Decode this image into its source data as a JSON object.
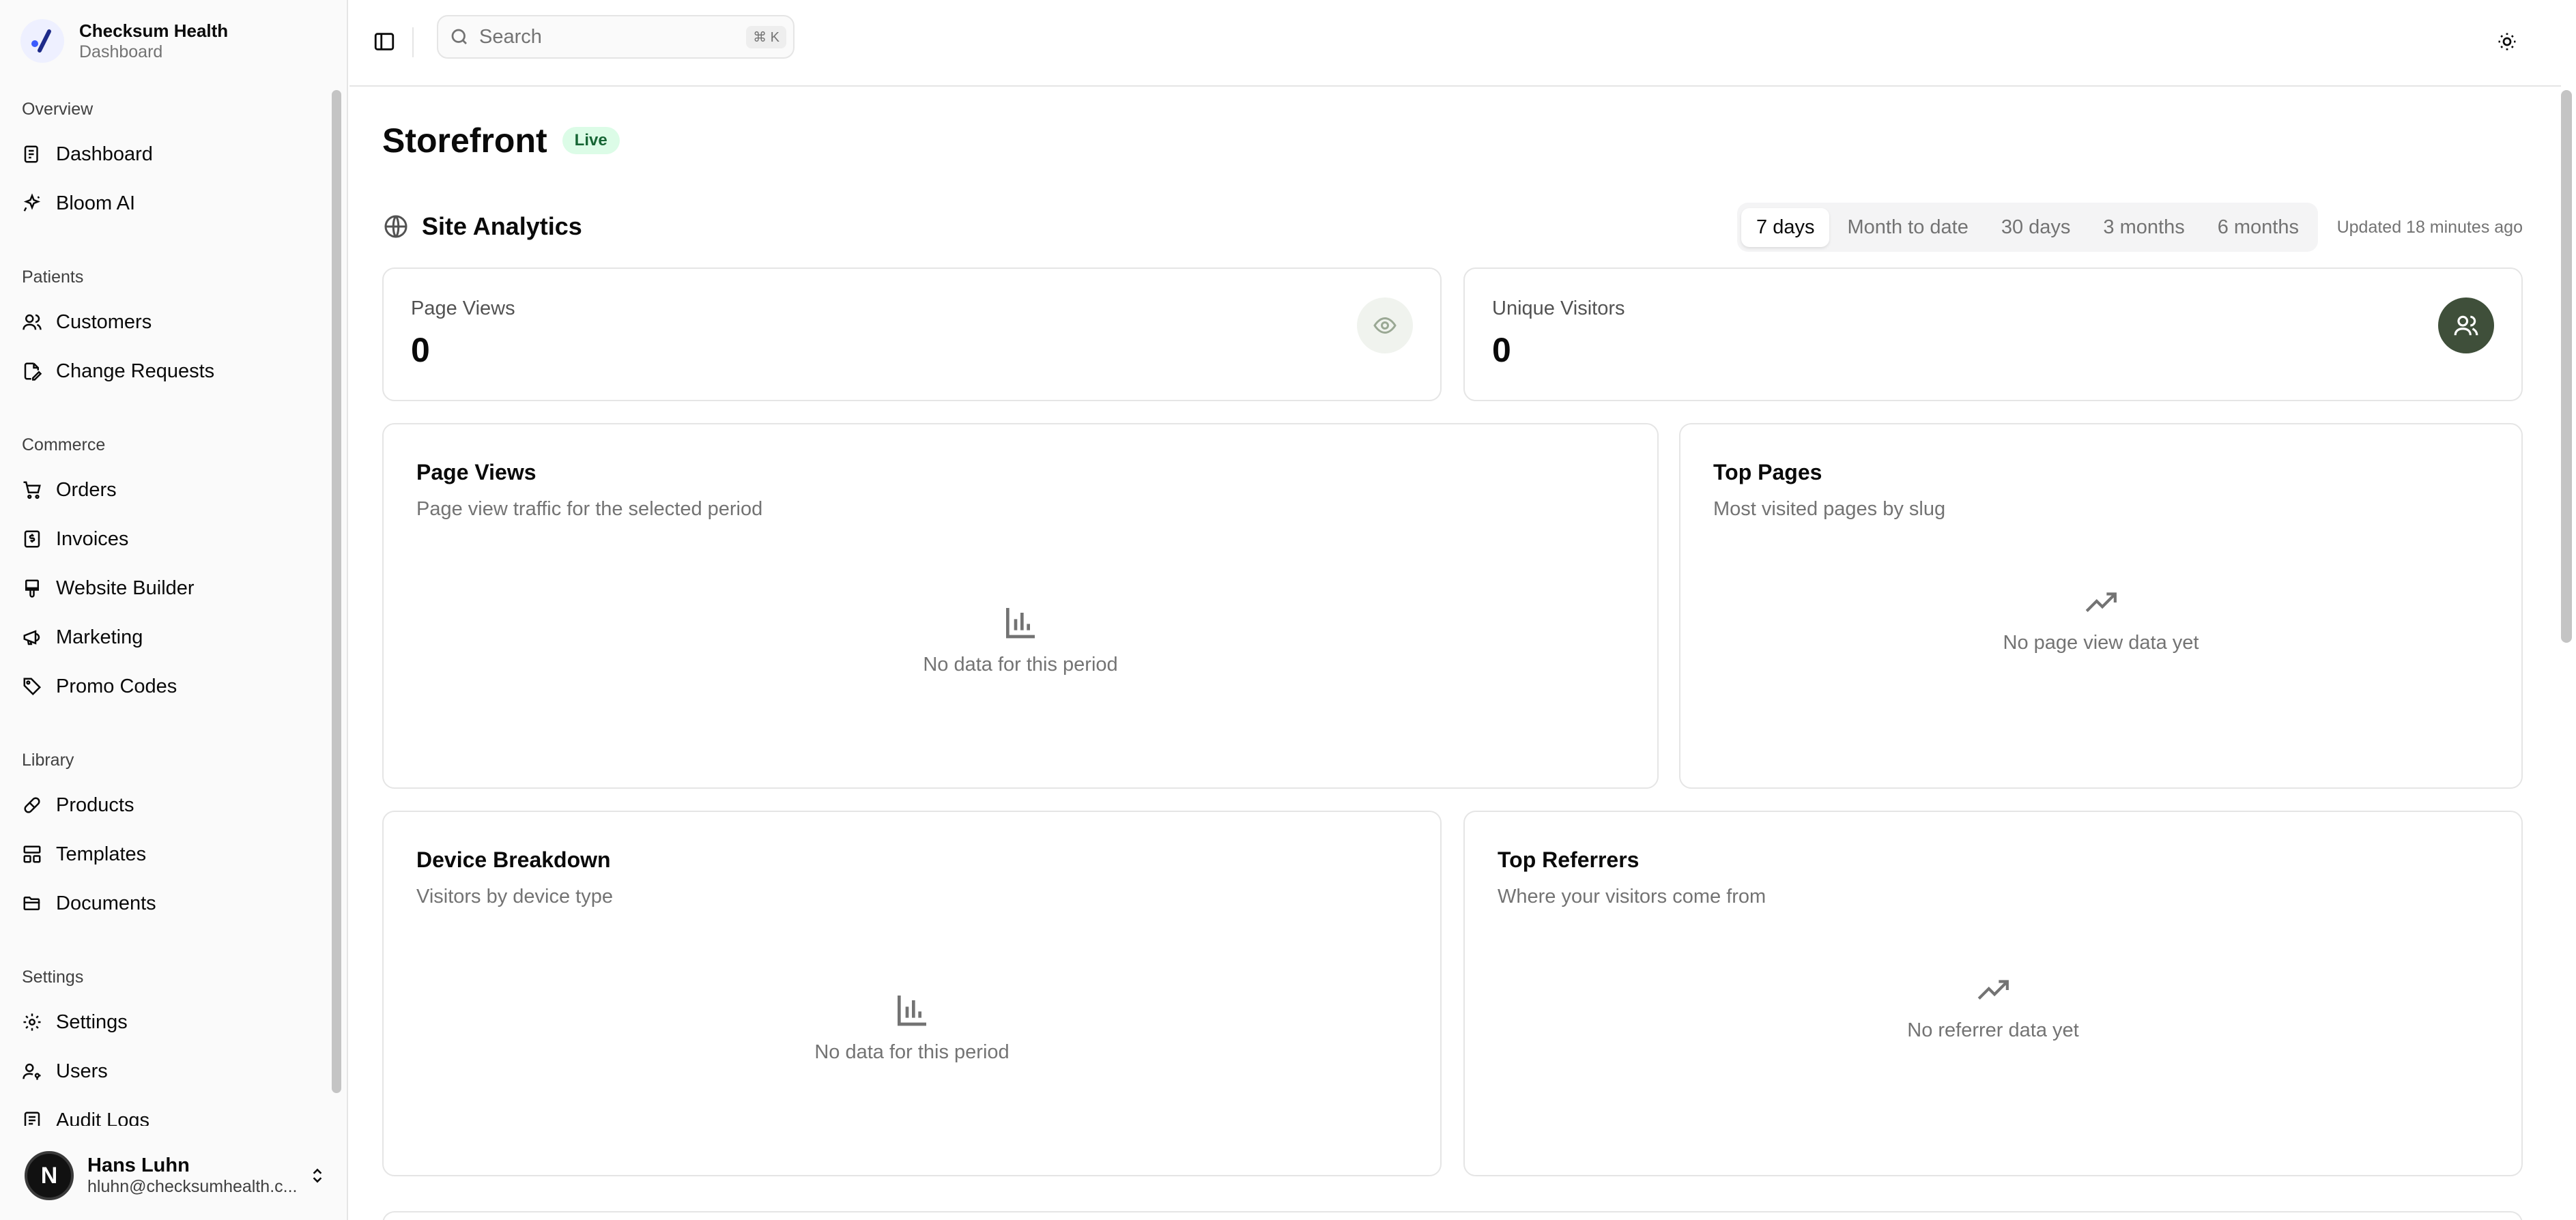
{
  "brand": {
    "name": "Checksum Health",
    "subtitle": "Dashboard"
  },
  "sidebar": {
    "groups": [
      {
        "label": "Overview",
        "items": [
          {
            "label": "Dashboard",
            "icon": "dashboard-icon"
          },
          {
            "label": "Bloom AI",
            "icon": "sparkles-icon"
          }
        ]
      },
      {
        "label": "Patients",
        "items": [
          {
            "label": "Customers",
            "icon": "users-icon"
          },
          {
            "label": "Change Requests",
            "icon": "file-edit-icon"
          }
        ]
      },
      {
        "label": "Commerce",
        "items": [
          {
            "label": "Orders",
            "icon": "cart-icon"
          },
          {
            "label": "Invoices",
            "icon": "invoice-icon"
          },
          {
            "label": "Website Builder",
            "icon": "brush-icon"
          },
          {
            "label": "Marketing",
            "icon": "megaphone-icon"
          },
          {
            "label": "Promo Codes",
            "icon": "tag-icon"
          }
        ]
      },
      {
        "label": "Library",
        "items": [
          {
            "label": "Products",
            "icon": "pill-icon"
          },
          {
            "label": "Templates",
            "icon": "layout-icon"
          },
          {
            "label": "Documents",
            "icon": "folder-icon"
          }
        ]
      },
      {
        "label": "Settings",
        "items": [
          {
            "label": "Settings",
            "icon": "gear-icon"
          },
          {
            "label": "Users",
            "icon": "user-key-icon"
          },
          {
            "label": "Audit Logs",
            "icon": "log-icon"
          }
        ]
      }
    ]
  },
  "user": {
    "initial": "N",
    "name": "Hans Luhn",
    "email": "hluhn@checksumhealth.c..."
  },
  "topbar": {
    "search_placeholder": "Search",
    "shortcut": "⌘ K"
  },
  "page": {
    "title": "Storefront",
    "badge": "Live"
  },
  "analytics": {
    "title": "Site Analytics",
    "periods": [
      "7 days",
      "Month to date",
      "30 days",
      "3 months",
      "6 months"
    ],
    "active_period": "7 days",
    "updated": "Updated 18 minutes ago"
  },
  "stats": [
    {
      "label": "Page Views",
      "value": "0"
    },
    {
      "label": "Unique Visitors",
      "value": "0"
    }
  ],
  "cards": {
    "page_views": {
      "title": "Page Views",
      "subtitle": "Page view traffic for the selected period",
      "empty": "No data for this period"
    },
    "top_pages": {
      "title": "Top Pages",
      "subtitle": "Most visited pages by slug",
      "empty": "No page view data yet"
    },
    "device": {
      "title": "Device Breakdown",
      "subtitle": "Visitors by device type",
      "empty": "No data for this period"
    },
    "referrers": {
      "title": "Top Referrers",
      "subtitle": "Where your visitors come from",
      "empty": "No referrer data yet"
    }
  },
  "colors": {
    "accent": "#3b5bfd",
    "badge_bg": "#dcfce7",
    "badge_text": "#166534",
    "visitor_icon_bg": "#3f4f3a"
  }
}
